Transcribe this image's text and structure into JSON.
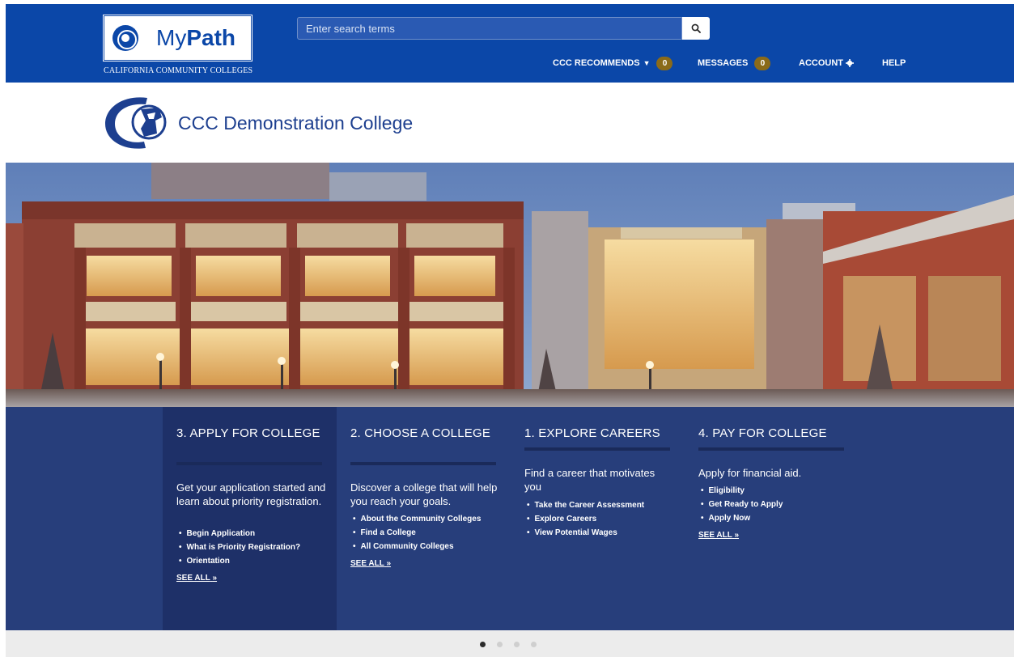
{
  "header": {
    "logo_text_prefix": "My",
    "logo_text_bold": "Path",
    "logo_subtitle": "CALIFORNIA COMMUNITY COLLEGES",
    "search_placeholder": "Enter search terms",
    "nav": {
      "recommends_label": "CCC RECOMMENDS",
      "recommends_count": "0",
      "messages_label": "MESSAGES",
      "messages_count": "0",
      "account_label": "ACCOUNT",
      "help_label": "HELP"
    }
  },
  "college": {
    "name": "CCC Demonstration College"
  },
  "steps": [
    {
      "title": "3. APPLY FOR COLLEGE",
      "description": "Get your application started and learn about priority registration.",
      "links": [
        "Begin Application",
        "What is Priority Registration?",
        "Orientation"
      ],
      "see_all": "SEE ALL"
    },
    {
      "title": "2. CHOOSE A COLLEGE",
      "description": "Discover a college that will help you reach your goals.",
      "links": [
        "About the Community Colleges",
        "Find a College",
        "All Community Colleges"
      ],
      "see_all": "SEE ALL"
    },
    {
      "title": "1. EXPLORE CAREERS",
      "description": "Find a career that motivates you",
      "links": [
        "Take the Career Assessment",
        "Explore Careers",
        "View Potential Wages"
      ]
    },
    {
      "title": "4. PAY FOR COLLEGE",
      "description": "Apply for financial aid.",
      "links": [
        "Eligibility",
        "Get Ready to Apply",
        "Apply Now"
      ],
      "see_all": "SEE ALL"
    }
  ],
  "carousel": {
    "active_index": 1,
    "total": 4
  },
  "icons": {
    "search": "search-icon",
    "account": "gear-icon",
    "recommends": "caret-down-icon",
    "see_all": "double-chevron-right-icon"
  },
  "colors": {
    "brand_blue": "#0b47a8",
    "band_blue": "#273e7b",
    "active_column": "#1e3068",
    "badge_gold": "#8a6a19"
  }
}
